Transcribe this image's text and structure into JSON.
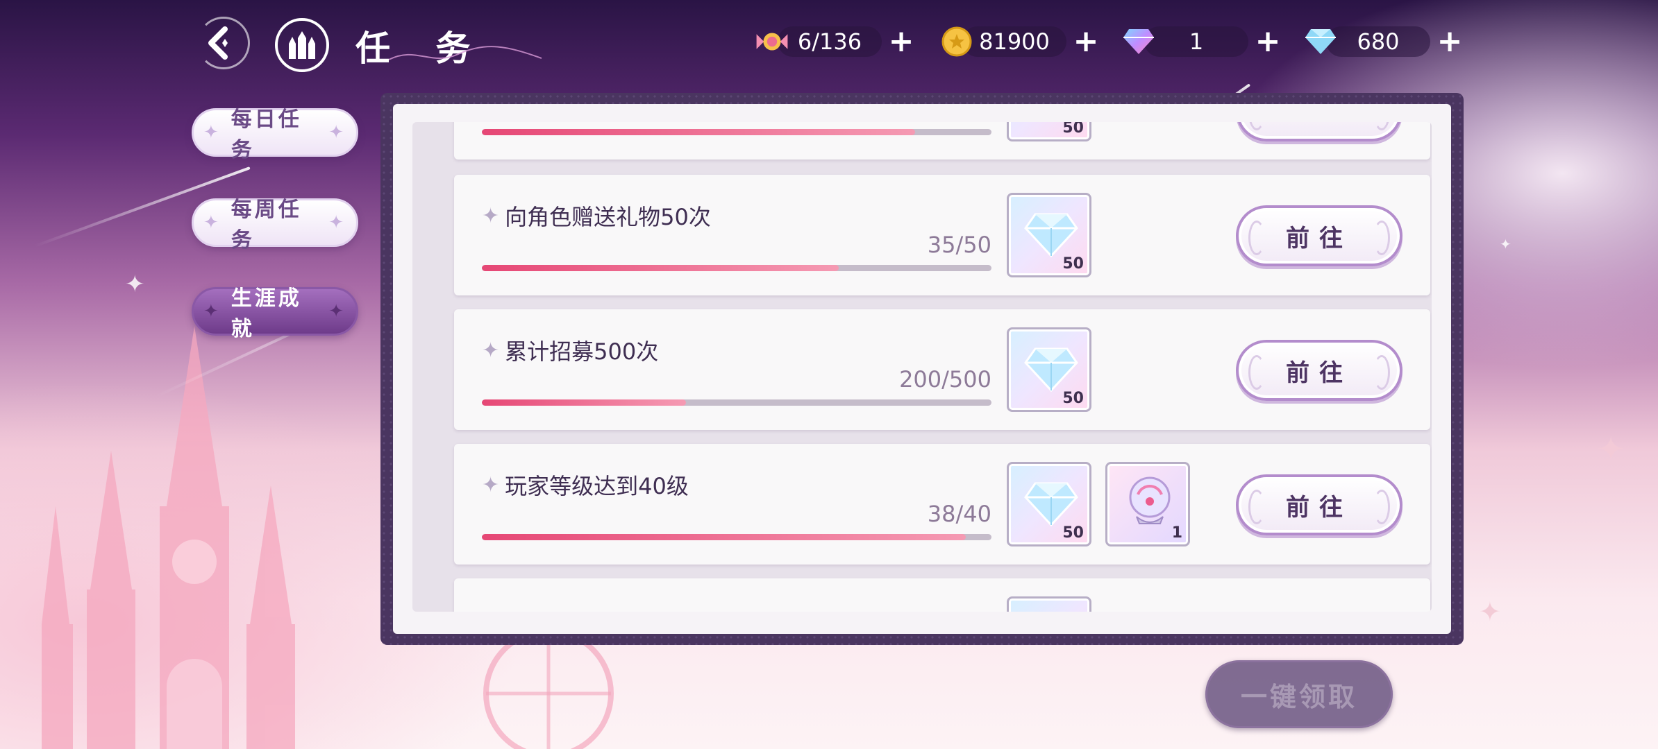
{
  "header": {
    "title": "任 务",
    "back_icon": "back-arrow-icon",
    "home_icon": "castle-icon"
  },
  "resources": [
    {
      "icon": "candy-icon",
      "value": "6/136"
    },
    {
      "icon": "gold-coin-icon",
      "value": "81900"
    },
    {
      "icon": "rainbow-diamond-icon",
      "value": "1"
    },
    {
      "icon": "blue-diamond-icon",
      "value": "680"
    }
  ],
  "tabs": [
    {
      "label": "每日任务",
      "active": false
    },
    {
      "label": "每周任务",
      "active": false
    },
    {
      "label": "生涯成就",
      "active": true
    }
  ],
  "tasks": [
    {
      "name": "",
      "progress": "",
      "fill": 0.85,
      "rewards": [
        {
          "type": "diamond",
          "count": "50"
        }
      ]
    },
    {
      "name": "向角色赠送礼物50次",
      "progress": "35/50",
      "fill": 0.7,
      "rewards": [
        {
          "type": "diamond",
          "count": "50"
        }
      ],
      "button": "前往"
    },
    {
      "name": "累计招募500次",
      "progress": "200/500",
      "fill": 0.4,
      "rewards": [
        {
          "type": "diamond",
          "count": "50"
        }
      ],
      "button": "前往"
    },
    {
      "name": "玩家等级达到40级",
      "progress": "38/40",
      "fill": 0.95,
      "rewards": [
        {
          "type": "diamond",
          "count": "50"
        },
        {
          "type": "crystal-ball",
          "count": "1"
        }
      ],
      "button": "前往"
    }
  ],
  "claim_all_label": "一键领取",
  "colors": {
    "accent": "#e64775",
    "button_border": "#b38ccc",
    "panel_frame": "#4a3560",
    "active_tab": "#8a58a6"
  }
}
